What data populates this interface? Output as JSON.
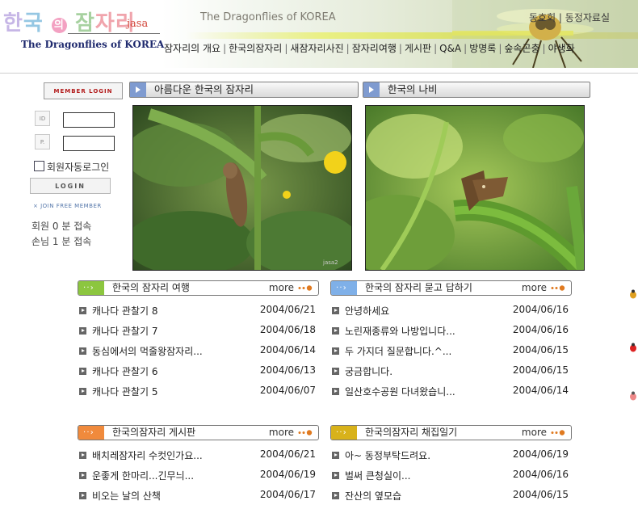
{
  "header": {
    "logo_chars": [
      "한",
      "국",
      "의",
      "잠",
      "자리"
    ],
    "logo_jasa": "jasa",
    "logo_en": "The Dragonflies of KOREA",
    "site_en": "The Dragonflies of KOREA",
    "toplinks": "동호회 | 동정자료실",
    "nav": [
      "잠자리의 개요",
      "한국의잠자리",
      "새잠자리사진",
      "잠자리여행",
      "게시판",
      "Q&A",
      "방명록",
      "숲속곤충",
      "야생화"
    ],
    "colors": {
      "nav_text": "#1f1f1f",
      "logo_en": "#1f2a6e",
      "jasa": "#d2453a"
    }
  },
  "login": {
    "member_login_label": "MEMBER LOGIN",
    "id_label": "ID",
    "pw_label": "P.",
    "autologin_label": "회원자동로그인",
    "login_button": "LOGIN",
    "join_link": "× JOIN FREE MEMBER",
    "member_count": "회원  0 분 접속",
    "guest_count": "손님  1 분 접속"
  },
  "photos": {
    "left_title": "아름다운 한국의 잠자리",
    "right_title": "한국의 나비",
    "watermark": "jasa2"
  },
  "boards": [
    {
      "title": "한국의 잠자리 여행",
      "more": "more",
      "cap_color": "#8cc63f",
      "items": [
        {
          "title": "캐나다 관찰기 8",
          "date": "2004/06/21"
        },
        {
          "title": "캐나다 관찰기 7",
          "date": "2004/06/18"
        },
        {
          "title": "동심에서의 먹줄왕잠자리...",
          "date": "2004/06/14"
        },
        {
          "title": "캐나다 관찰기 6",
          "date": "2004/06/13"
        },
        {
          "title": "캐나다 관찰기 5",
          "date": "2004/06/07"
        }
      ]
    },
    {
      "title": "한국의 잠자리 묻고 답하기",
      "more": "more",
      "cap_color": "#7fb0e8",
      "items": [
        {
          "title": "안녕하세요",
          "date": "2004/06/16"
        },
        {
          "title": "노린재종류와 나방입니다...",
          "date": "2004/06/16"
        },
        {
          "title": "두 가지더 질문합니다.^...",
          "date": "2004/06/15"
        },
        {
          "title": "궁금합니다.",
          "date": "2004/06/15"
        },
        {
          "title": "일산호수공원 다녀왔습니...",
          "date": "2004/06/14"
        }
      ]
    },
    {
      "title": "한국의잠자리 게시판",
      "more": "more",
      "cap_color": "#f08a3c",
      "items": [
        {
          "title": "배치레잠자리 수컷인가요...",
          "date": "2004/06/21"
        },
        {
          "title": "운좋게 한마리...긴무늬...",
          "date": "2004/06/19"
        },
        {
          "title": "비오는 날의 산책",
          "date": "2004/06/17"
        }
      ]
    },
    {
      "title": "한국의잠자리 채집일기",
      "more": "more",
      "cap_color": "#d8b21a",
      "items": [
        {
          "title": "아~ 동정부탁드려요.",
          "date": "2004/06/19"
        },
        {
          "title": "벌써 큰청실이...",
          "date": "2004/06/16"
        },
        {
          "title": "잔산의 옆모습",
          "date": "2004/06/15"
        }
      ]
    }
  ]
}
